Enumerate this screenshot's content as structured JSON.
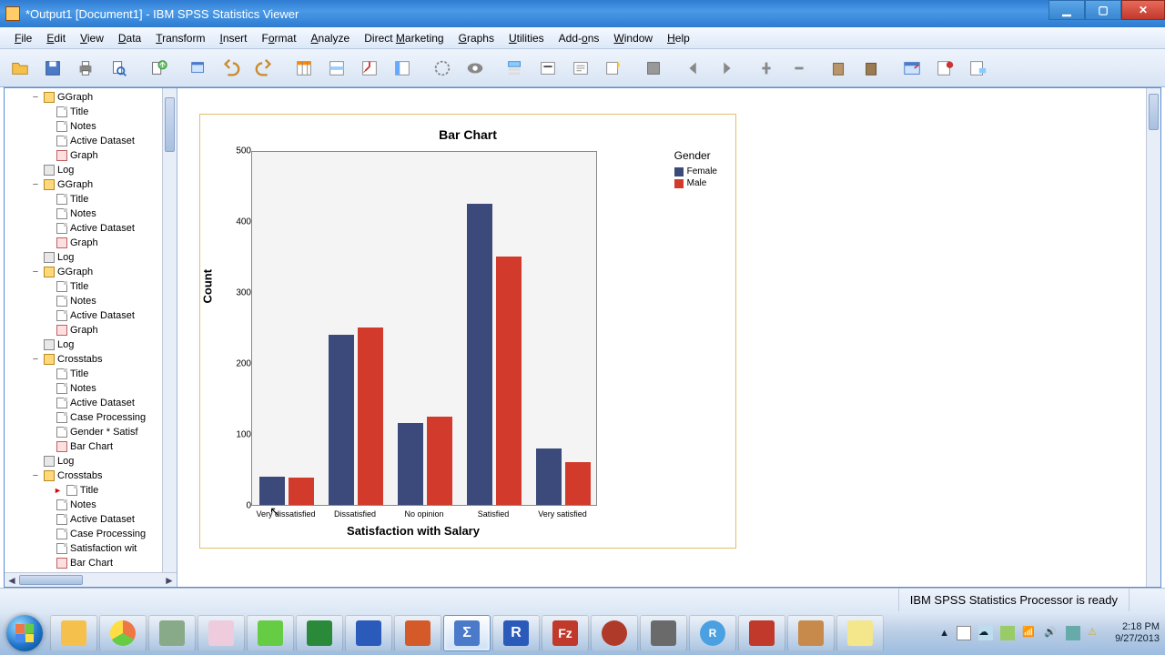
{
  "window": {
    "title": "*Output1 [Document1] - IBM SPSS Statistics Viewer"
  },
  "menu": {
    "file": "File",
    "edit": "Edit",
    "view": "View",
    "data": "Data",
    "transform": "Transform",
    "insert": "Insert",
    "format": "Format",
    "analyze": "Analyze",
    "dm": "Direct Marketing",
    "graphs": "Graphs",
    "utilities": "Utilities",
    "addons": "Add-ons",
    "window": "Window",
    "help": "Help"
  },
  "outline": {
    "items": [
      {
        "depth": 2,
        "twisty": "−",
        "icon": "book",
        "label": "GGraph"
      },
      {
        "depth": 3,
        "icon": "page",
        "label": "Title"
      },
      {
        "depth": 3,
        "icon": "page",
        "label": "Notes"
      },
      {
        "depth": 3,
        "icon": "page",
        "label": "Active Dataset"
      },
      {
        "depth": 3,
        "icon": "graph",
        "label": "Graph"
      },
      {
        "depth": 2,
        "icon": "log",
        "label": "Log"
      },
      {
        "depth": 2,
        "twisty": "−",
        "icon": "book",
        "label": "GGraph"
      },
      {
        "depth": 3,
        "icon": "page",
        "label": "Title"
      },
      {
        "depth": 3,
        "icon": "page",
        "label": "Notes"
      },
      {
        "depth": 3,
        "icon": "page",
        "label": "Active Dataset"
      },
      {
        "depth": 3,
        "icon": "graph",
        "label": "Graph"
      },
      {
        "depth": 2,
        "icon": "log",
        "label": "Log"
      },
      {
        "depth": 2,
        "twisty": "−",
        "icon": "book",
        "label": "GGraph"
      },
      {
        "depth": 3,
        "icon": "page",
        "label": "Title"
      },
      {
        "depth": 3,
        "icon": "page",
        "label": "Notes"
      },
      {
        "depth": 3,
        "icon": "page",
        "label": "Active Dataset"
      },
      {
        "depth": 3,
        "icon": "graph",
        "label": "Graph"
      },
      {
        "depth": 2,
        "icon": "log",
        "label": "Log"
      },
      {
        "depth": 2,
        "twisty": "−",
        "icon": "book",
        "label": "Crosstabs"
      },
      {
        "depth": 3,
        "icon": "page",
        "label": "Title"
      },
      {
        "depth": 3,
        "icon": "page",
        "label": "Notes"
      },
      {
        "depth": 3,
        "icon": "page",
        "label": "Active Dataset"
      },
      {
        "depth": 3,
        "icon": "page",
        "label": "Case Processing"
      },
      {
        "depth": 3,
        "icon": "page",
        "label": "Gender * Satisf"
      },
      {
        "depth": 3,
        "icon": "graph",
        "label": "Bar Chart"
      },
      {
        "depth": 2,
        "icon": "log",
        "label": "Log"
      },
      {
        "depth": 2,
        "twisty": "−",
        "icon": "book",
        "label": "Crosstabs"
      },
      {
        "depth": 3,
        "icon": "page",
        "label": "Title",
        "current": true
      },
      {
        "depth": 3,
        "icon": "page",
        "label": "Notes"
      },
      {
        "depth": 3,
        "icon": "page",
        "label": "Active Dataset"
      },
      {
        "depth": 3,
        "icon": "page",
        "label": "Case Processing"
      },
      {
        "depth": 3,
        "icon": "page",
        "label": "Satisfaction wit"
      },
      {
        "depth": 3,
        "icon": "graph",
        "label": "Bar Chart"
      }
    ]
  },
  "chart_data": {
    "type": "bar",
    "title": "Bar Chart",
    "xlabel": "Satisfaction with Salary",
    "ylabel": "Count",
    "categories": [
      "Very dissatisfied",
      "Dissatisfied",
      "No opinion",
      "Satisfied",
      "Very satisfied"
    ],
    "series": [
      {
        "name": "Female",
        "color": "#3b4a7a",
        "values": [
          40,
          240,
          115,
          425,
          80
        ]
      },
      {
        "name": "Male",
        "color": "#d23b2b",
        "values": [
          38,
          250,
          125,
          350,
          60
        ]
      }
    ],
    "legend_title": "Gender",
    "ylim": [
      0,
      500
    ],
    "yticks": [
      0,
      100,
      200,
      300,
      400,
      500
    ]
  },
  "status": {
    "processor": "IBM SPSS Statistics Processor is ready"
  },
  "clock": {
    "time": "2:18 PM",
    "date": "9/27/2013"
  }
}
